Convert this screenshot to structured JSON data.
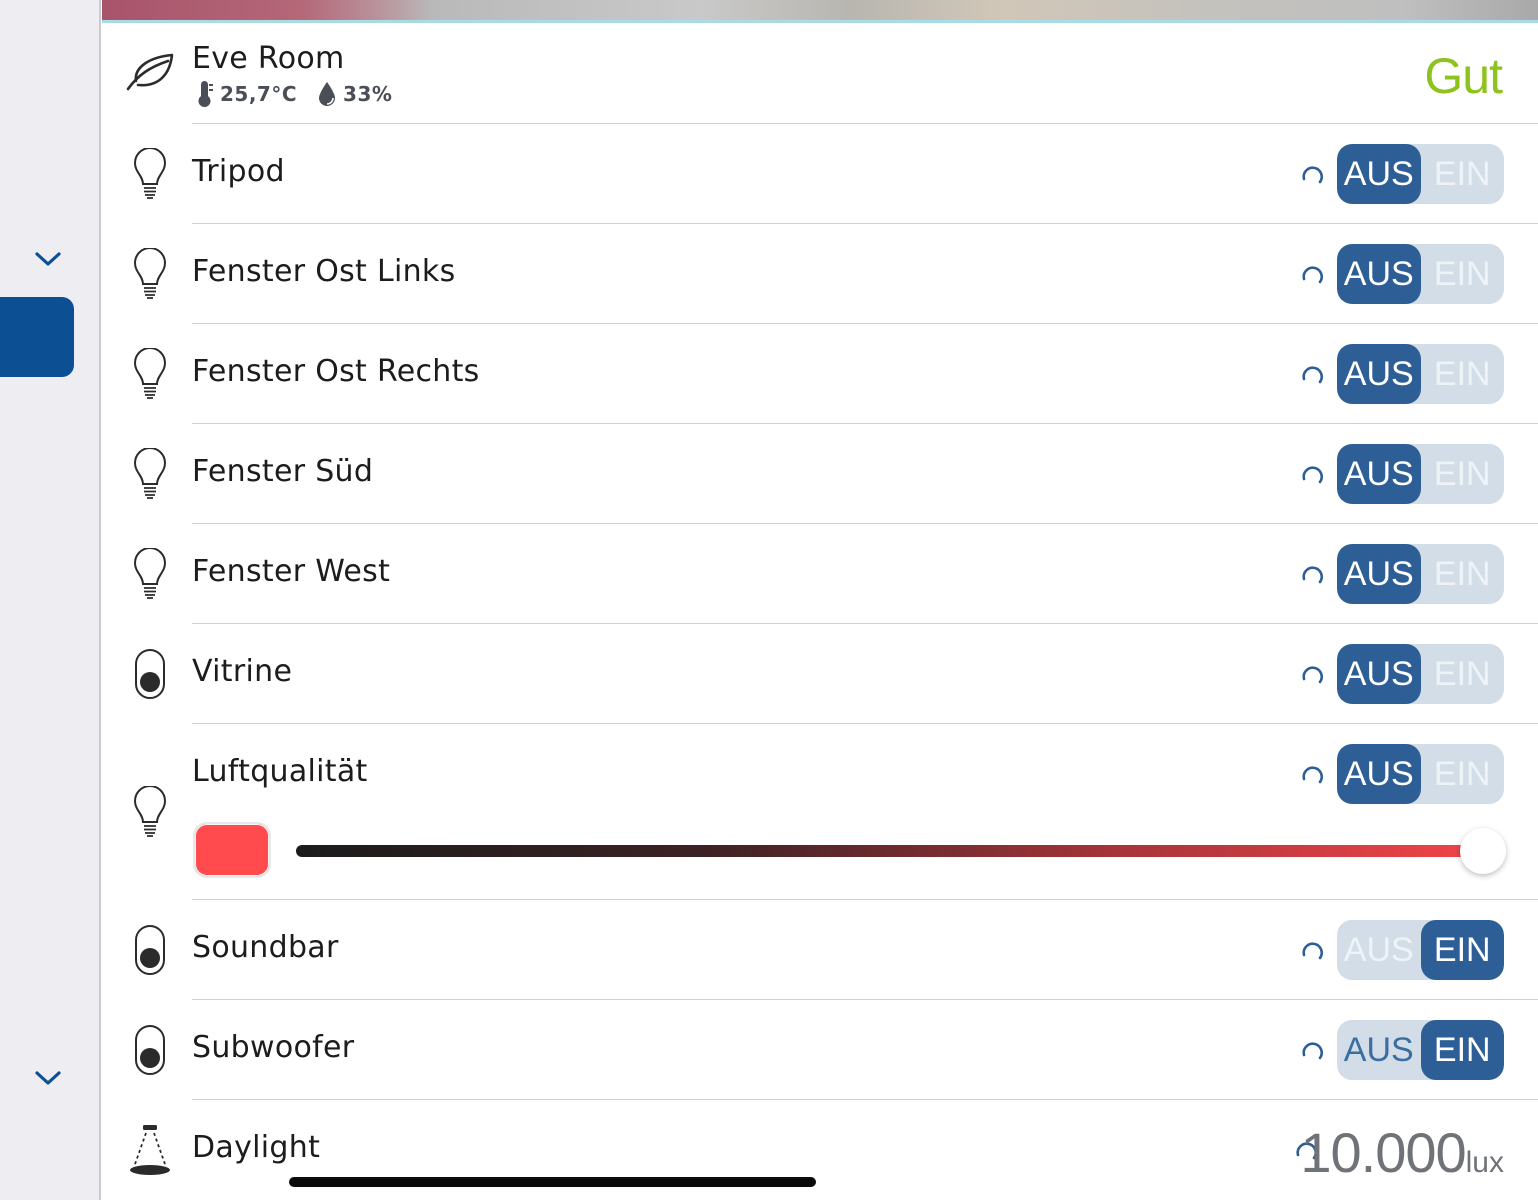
{
  "header": {
    "room_name": "Eve Room",
    "temperature": "25,7°C",
    "humidity": "33%",
    "air_status": "Gut",
    "air_status_color": "#8dc21f"
  },
  "switch_labels": {
    "off": "AUS",
    "on": "EIN"
  },
  "accent_color": "#2d5f96",
  "devices": [
    {
      "name": "Tripod",
      "icon": "lightbulb-icon",
      "state": "AUS"
    },
    {
      "name": "Fenster Ost Links",
      "icon": "lightbulb-icon",
      "state": "AUS"
    },
    {
      "name": "Fenster Ost Rechts",
      "icon": "lightbulb-icon",
      "state": "AUS"
    },
    {
      "name": "Fenster Süd",
      "icon": "lightbulb-icon",
      "state": "AUS"
    },
    {
      "name": "Fenster West",
      "icon": "lightbulb-icon",
      "state": "AUS"
    },
    {
      "name": "Vitrine",
      "icon": "toggle-switch-icon",
      "state": "AUS"
    },
    {
      "name": "Luftqualität",
      "icon": "lightbulb-icon",
      "state": "AUS",
      "color": "#ff4a4e",
      "brightness": 1.0
    },
    {
      "name": "Soundbar",
      "icon": "toggle-switch-icon",
      "state": "EIN"
    },
    {
      "name": "Subwoofer",
      "icon": "toggle-switch-icon",
      "state": "EIN"
    }
  ],
  "daylight": {
    "name": "Daylight",
    "icon": "light-sensor-icon",
    "value": "10.000",
    "unit": "lux"
  }
}
